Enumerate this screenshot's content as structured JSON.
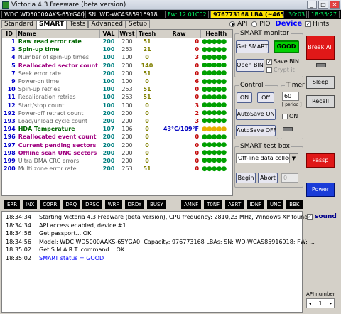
{
  "window": {
    "title": "Victoria 4.3 Freeware (beta version)",
    "min": "_",
    "max": "□",
    "close": "✕"
  },
  "status": {
    "drive": "WDC WD5000AAKS-65YGA0",
    "serial": "SN: WD-WCAS85916918",
    "firmware": "Fw: 12.01C02",
    "lba": "976773168 LBA (~465 GB)",
    "date": "30:03",
    "time": "18:35:27"
  },
  "tabs": [
    "Standard",
    "SMART",
    "Tests",
    "Advanced",
    "Setup"
  ],
  "interface": {
    "api": "API",
    "pio": "PIO",
    "device": "Device 1"
  },
  "hints_label": "Hints",
  "table": {
    "headers": [
      "ID",
      "Name",
      "VAL",
      "Wrst",
      "Tresh",
      "Raw",
      "Health"
    ],
    "rows": [
      {
        "id": "1",
        "name": "Raw read error rate",
        "val": "200",
        "wrst": "200",
        "tresh": "51",
        "raw": "0",
        "health": "●●●●●",
        "style": "ok"
      },
      {
        "id": "3",
        "name": "Spin-up time",
        "val": "100",
        "wrst": "253",
        "tresh": "21",
        "raw": "0",
        "health": "●●●●●",
        "style": "ok"
      },
      {
        "id": "4",
        "name": "Number of spin-up times",
        "val": "100",
        "wrst": "100",
        "tresh": "0",
        "raw": "3",
        "health": "●●●●●",
        "style": "grey"
      },
      {
        "id": "5",
        "name": "Reallocated sector count",
        "val": "200",
        "wrst": "200",
        "tresh": "140",
        "raw": "0",
        "health": "●●●●●",
        "style": "bad"
      },
      {
        "id": "7",
        "name": "Seek error rate",
        "val": "200",
        "wrst": "200",
        "tresh": "51",
        "raw": "0",
        "health": "●●●●●",
        "style": "grey"
      },
      {
        "id": "9",
        "name": "Power-on time",
        "val": "100",
        "wrst": "100",
        "tresh": "0",
        "raw": "6",
        "health": "●●●●●",
        "style": "grey"
      },
      {
        "id": "10",
        "name": "Spin-up retries",
        "val": "100",
        "wrst": "253",
        "tresh": "51",
        "raw": "0",
        "health": "●●●●●",
        "style": "grey"
      },
      {
        "id": "11",
        "name": "Recalibration retries",
        "val": "100",
        "wrst": "253",
        "tresh": "51",
        "raw": "0",
        "health": "●●●●●",
        "style": "grey"
      },
      {
        "id": "12",
        "name": "Start/stop count",
        "val": "100",
        "wrst": "100",
        "tresh": "0",
        "raw": "3",
        "health": "●●●●●",
        "style": "grey"
      },
      {
        "id": "192",
        "name": "Power-off retract count",
        "val": "200",
        "wrst": "200",
        "tresh": "0",
        "raw": "2",
        "health": "●●●●●",
        "style": "grey"
      },
      {
        "id": "193",
        "name": "Load/unload cycle count",
        "val": "200",
        "wrst": "200",
        "tresh": "0",
        "raw": "3",
        "health": "●●●●●",
        "style": "grey"
      },
      {
        "id": "194",
        "name": "HDA Temperature",
        "val": "107",
        "wrst": "106",
        "tresh": "0",
        "raw": "43°C/109°F",
        "health": "●●●●●",
        "style": "ok",
        "rawstyle": "temp",
        "hstyle": "yellow"
      },
      {
        "id": "196",
        "name": "Reallocated event count",
        "val": "200",
        "wrst": "200",
        "tresh": "0",
        "raw": "0",
        "health": "●●●●●",
        "style": "bad"
      },
      {
        "id": "197",
        "name": "Current pending sectors",
        "val": "200",
        "wrst": "200",
        "tresh": "0",
        "raw": "0",
        "health": "●●●●●",
        "style": "bad"
      },
      {
        "id": "198",
        "name": "Offline scan UNC sectors",
        "val": "200",
        "wrst": "200",
        "tresh": "0",
        "raw": "0",
        "health": "●●●●●",
        "style": "bad"
      },
      {
        "id": "199",
        "name": "Ultra DMA CRC errors",
        "val": "200",
        "wrst": "200",
        "tresh": "0",
        "raw": "0",
        "health": "●●●●●",
        "style": "grey"
      },
      {
        "id": "200",
        "name": "Multi zone error rate",
        "val": "200",
        "wrst": "253",
        "tresh": "51",
        "raw": "0",
        "health": "●●●●●",
        "style": "grey"
      }
    ]
  },
  "smart_monitor": {
    "label": "SMART monitor",
    "get_smart": "Get SMART",
    "good": "GOOD",
    "open_bin": "Open BIN",
    "save_bin": "Save BIN",
    "crypt_it": "Crypt it"
  },
  "control": {
    "label": "Control",
    "on": "ON",
    "off": "Off",
    "autosave_on": "AutoSave ON",
    "autosave_off": "AutoSave OFF"
  },
  "timer": {
    "label": "Timer",
    "value": "60",
    "period": "[ period ]",
    "on_label": "ON"
  },
  "test_box": {
    "label": "SMART test box",
    "selected": "Off-line data collect",
    "begin": "Begin",
    "abort": "Abort",
    "value": "0"
  },
  "side": {
    "break_all": "Break All",
    "sleep": "Sleep",
    "recall": "Recall",
    "passp": "Passp",
    "power": "Power"
  },
  "flags": [
    "ERR",
    "INX",
    "CORR",
    "DRQ",
    "DRSC",
    "WRF",
    "DRDY",
    "BUSY",
    "AMNF",
    "T0NF",
    "ABRT",
    "IDNF",
    "UNC",
    "BBK"
  ],
  "log": [
    {
      "time": "18:34:34",
      "msg": "Starting Victoria 4.3 Freeware (beta version), CPU frequency: 2810,23 MHz, Windows XP found."
    },
    {
      "time": "18:34:34",
      "msg": "API access enabled, device #1"
    },
    {
      "time": "18:34:56",
      "msg": "Get passport... OK"
    },
    {
      "time": "18:34:56",
      "msg": "Model: WDC WD5000AAKS-65YGA0; Capacity: 976773168 LBAs; SN: WD-WCAS85916918; FW: ..."
    },
    {
      "time": "18:35:02",
      "msg": "Get S.M.A.R.T. command... OK"
    },
    {
      "time": "18:35:02",
      "msg": "SMART status = GOOD"
    }
  ],
  "sound_label": "sound",
  "api_number": {
    "label": "API number",
    "value": "1"
  }
}
